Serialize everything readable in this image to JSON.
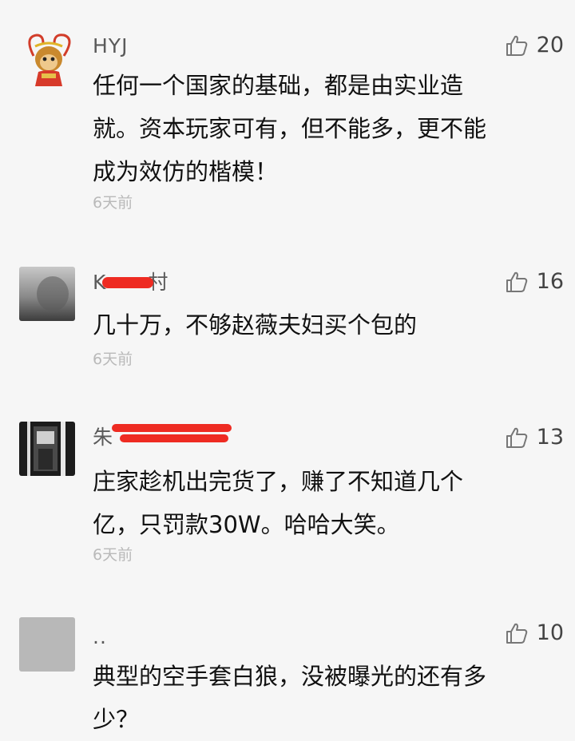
{
  "comments": [
    {
      "username": "HYJ",
      "likes": "20",
      "lines": [
        "任何一个国家的基础，都是由实业造",
        "就。资本玩家可有，但不能多，更不能",
        "成为效仿的楷模！"
      ],
      "time": "6天前",
      "avatar_icon": "monkey-king-avatar-icon"
    },
    {
      "username": "K",
      "username_tail": "村",
      "username_redacted": true,
      "likes": "16",
      "lines": [
        "几十万，不够赵薇夫妇买个包的"
      ],
      "time": "6天前",
      "avatar_icon": "gray-photo-avatar-icon"
    },
    {
      "username": "朱",
      "username_redacted": true,
      "likes": "13",
      "lines": [
        "庄家趁机出完货了，赚了不知道几个",
        "亿，只罚款30W。哈哈大笑。"
      ],
      "time": "6天前",
      "avatar_icon": "elevator-photo-avatar-icon"
    },
    {
      "username": "..",
      "likes": "10",
      "lines": [
        "典型的空手套白狼，没被曝光的还有多",
        "少？"
      ],
      "avatar_icon": "gray-square-avatar-icon"
    }
  ],
  "colors": {
    "background": "#f6f6f6",
    "redaction": "#ee2b22",
    "timestamp": "#b9b9b9",
    "icon": "#777777"
  }
}
